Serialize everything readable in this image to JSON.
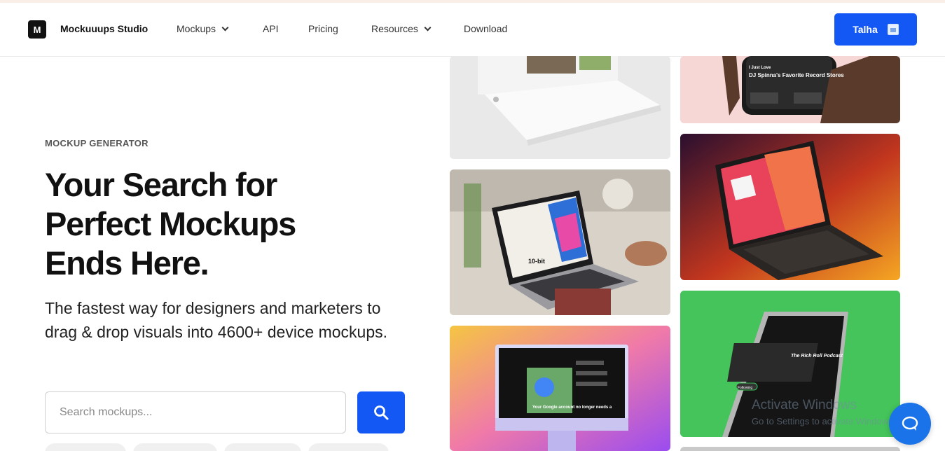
{
  "header": {
    "logo_letter": "M",
    "brand": "Mockuuups Studio",
    "nav": [
      {
        "label": "Mockups"
      },
      {
        "label": "API"
      },
      {
        "label": "Pricing"
      },
      {
        "label": "Resources"
      },
      {
        "label": "Download"
      }
    ],
    "user_name": "Talha"
  },
  "hero": {
    "eyebrow": "MOCKUP GENERATOR",
    "headline_lines": [
      "Your Search for",
      "Perfect Mockups",
      "Ends Here."
    ],
    "subtitle": "The fastest way for designers and marketers to drag & drop visuals into 4600+ device mockups.",
    "search": {
      "placeholder": "Search mockups..."
    }
  },
  "gallery": {
    "phone_text_top": "I Just Love",
    "phone_text_main": "DJ Spinna's Favorite Record Stores",
    "laptop_screen_text": "10-bit",
    "podcast_title": "The Rich Roll Podcast",
    "podcast_button": "Following",
    "monitor_text": "Your Google account no longer needs a"
  },
  "overlay": {
    "activate_title": "Activate Windows",
    "activate_sub": "Go to Settings to activate Windows."
  },
  "colors": {
    "accent": "#1358f5",
    "text": "#111111"
  }
}
